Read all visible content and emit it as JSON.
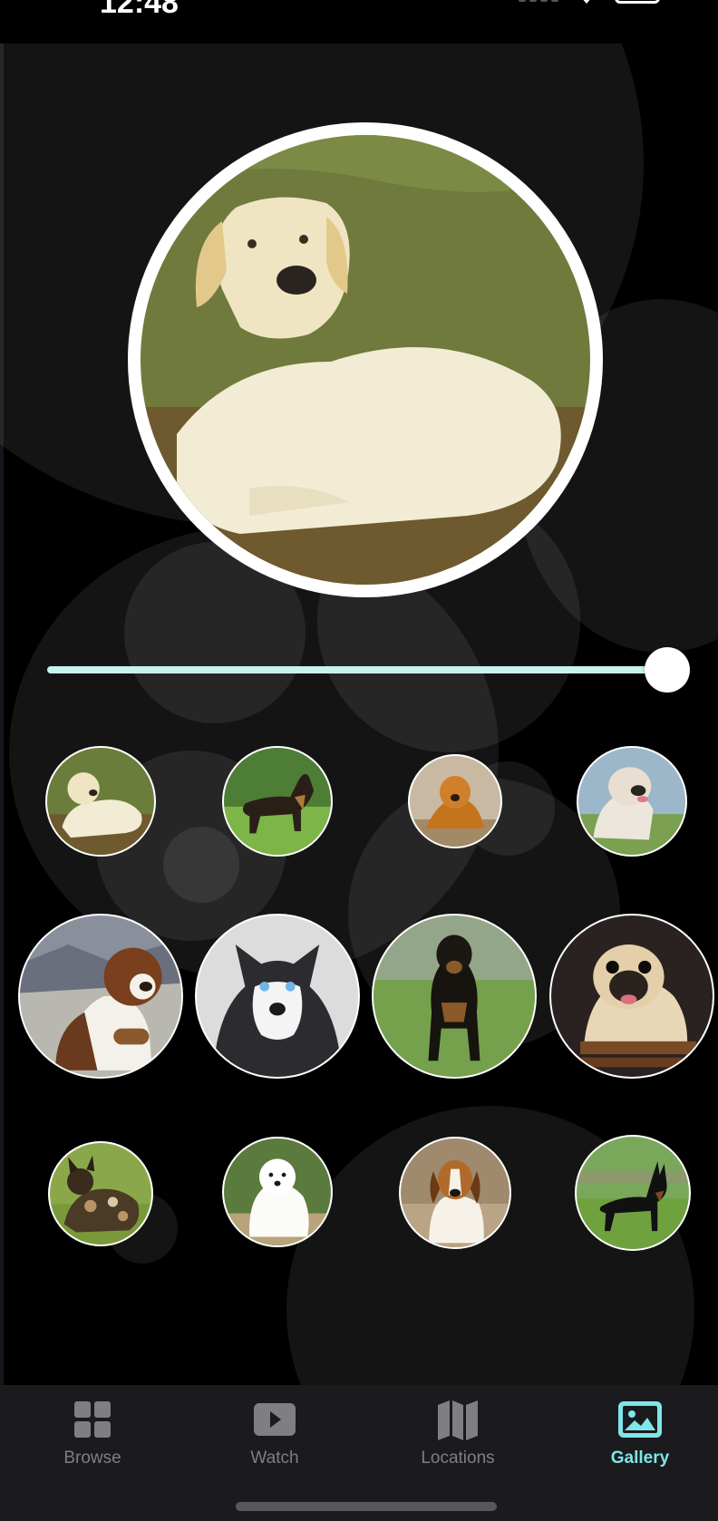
{
  "status_bar": {
    "time": "12:48"
  },
  "hero": {
    "photo": "labrador-retriever"
  },
  "slider": {
    "value": 1.0
  },
  "thumbnails": [
    {
      "breed": "labrador-retriever"
    },
    {
      "breed": "german-shepherd"
    },
    {
      "breed": "golden-retriever"
    },
    {
      "breed": "english-bulldog"
    },
    {
      "breed": "saint-bernard"
    },
    {
      "breed": "siberian-husky"
    },
    {
      "breed": "rottweiler"
    },
    {
      "breed": "pug"
    },
    {
      "breed": "african-wild-dog"
    },
    {
      "breed": "samoyed"
    },
    {
      "breed": "beagle"
    },
    {
      "breed": "doberman"
    }
  ],
  "tab_bar": {
    "items": [
      {
        "label": "Browse",
        "icon": "grid-icon"
      },
      {
        "label": "Watch",
        "icon": "play-icon"
      },
      {
        "label": "Locations",
        "icon": "map-icon"
      },
      {
        "label": "Gallery",
        "icon": "photo-icon"
      }
    ],
    "active": "Gallery"
  },
  "colors": {
    "accent": "#7fe6ea",
    "slider_track": "#c6f3ef",
    "tab_bar_bg": "#1b1b1d",
    "tab_inactive": "#7e7e83"
  }
}
